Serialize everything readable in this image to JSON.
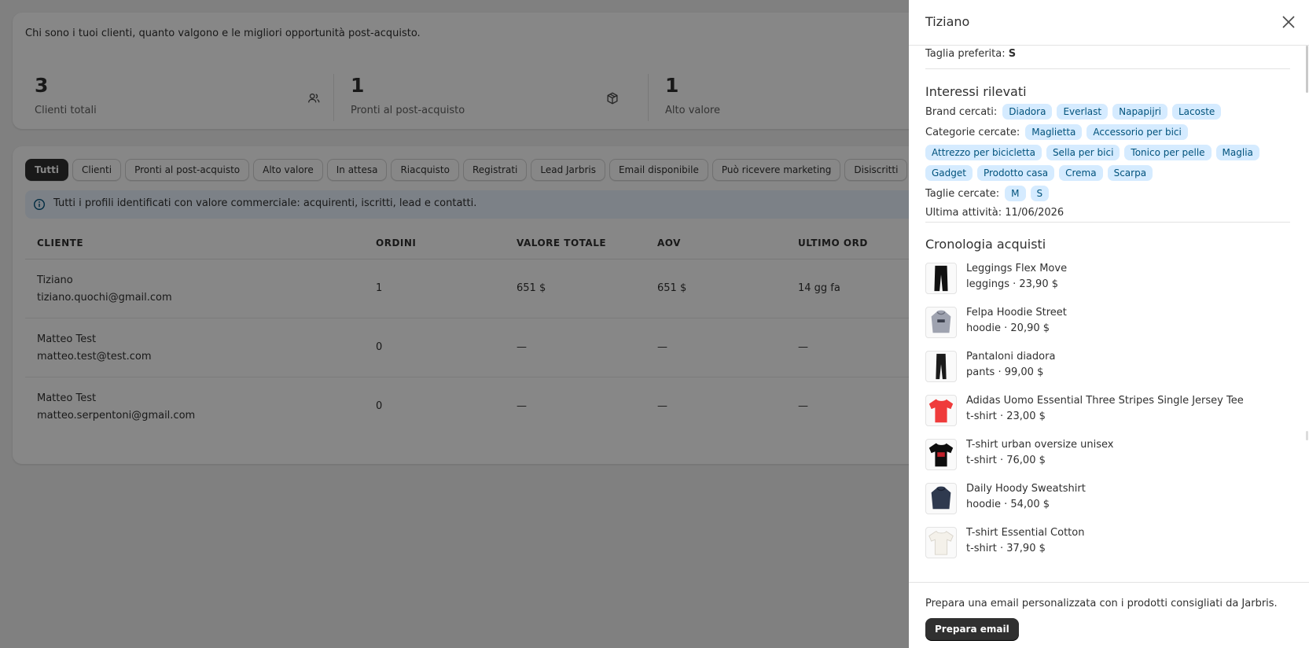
{
  "header": {
    "intro": "Chi sono i tuoi clienti, quanto valgono e le migliori opportunità post-acquisto."
  },
  "stats": [
    {
      "value": "3",
      "label": "Clienti totali",
      "icon": "users-icon"
    },
    {
      "value": "1",
      "label": "Pronti al post-acquisto",
      "icon": "package-icon"
    },
    {
      "value": "1",
      "label": "Alto valore",
      "icon": ""
    }
  ],
  "filters": [
    "Tutti",
    "Clienti",
    "Pronti al post-acquisto",
    "Alto valore",
    "In attesa",
    "Riacquisto",
    "Registrati",
    "Lead Jarbris",
    "Email disponibile",
    "Può ricevere marketing",
    "Disiscritti"
  ],
  "active_filter": "Tutti",
  "banner": {
    "text": "Tutti i profili identificati con valore commerciale: acquirenti, iscritti, lead e contatti.",
    "icon": "info-icon"
  },
  "table": {
    "headers": [
      "CLIENTE",
      "ORDINI",
      "VALORE TOTALE",
      "AOV",
      "ULTIMO ORD"
    ],
    "rows": [
      {
        "name": "Tiziano",
        "email": "tiziano.quochi@gmail.com",
        "orders": "1",
        "total": "651 $",
        "aov": "651 $",
        "last": "14 gg fa"
      },
      {
        "name": "Matteo Test",
        "email": "matteo.test@test.com",
        "orders": "0",
        "total": "—",
        "aov": "—",
        "last": "—"
      },
      {
        "name": "Matteo Test",
        "email": "matteo.serpentoni@gmail.com",
        "orders": "0",
        "total": "—",
        "aov": "—",
        "last": "—"
      }
    ]
  },
  "drawer": {
    "title": "Tiziano",
    "preferred_size_label": "Taglia preferita:",
    "preferred_size_value": "S",
    "interests_title": "Interessi rilevati",
    "brands_label": "Brand cercati:",
    "brands": [
      "Diadora",
      "Everlast",
      "Napapijri",
      "Lacoste"
    ],
    "categories_label": "Categorie cercate:",
    "categories_row1": [
      "Maglietta",
      "Accessorio per bici"
    ],
    "categories_row2": [
      "Attrezzo per bicicletta",
      "Sella per bici",
      "Tonico per pelle",
      "Maglia"
    ],
    "categories_row3": [
      "Gadget",
      "Prodotto casa",
      "Crema",
      "Scarpa"
    ],
    "sizes_label": "Taglie cercate:",
    "sizes": [
      "M",
      "S"
    ],
    "last_activity": "Ultima attività: 11/06/2026",
    "history_title": "Cronologia acquisti",
    "purchases": [
      {
        "name": "Leggings Flex Move",
        "meta": "leggings · 23,90 $",
        "thumb": "leggings"
      },
      {
        "name": "Felpa Hoodie Street",
        "meta": "hoodie · 20,90 $",
        "thumb": "hoodie-grey"
      },
      {
        "name": "Pantaloni diadora",
        "meta": "pants · 99,00 $",
        "thumb": "pants"
      },
      {
        "name": "Adidas Uomo Essential Three Stripes Single Jersey Tee",
        "meta": "t-shirt · 23,00 $",
        "thumb": "tee-red"
      },
      {
        "name": "T-shirt urban oversize unisex",
        "meta": "t-shirt · 76,00 $",
        "thumb": "tee-black"
      },
      {
        "name": "Daily Hoody Sweatshirt",
        "meta": "hoodie · 54,00 $",
        "thumb": "hoodie-navy"
      },
      {
        "name": "T-shirt Essential Cotton",
        "meta": "t-shirt · 37,90 $",
        "thumb": "tee-white"
      }
    ],
    "footer_text": "Prepara una email personalizzata con i prodotti consigliati da Jarbris.",
    "footer_button": "Prepara email"
  },
  "colors": {
    "overlay": "rgba(0,0,0,0.47)",
    "tag_bg": "#d5ebff",
    "tag_text": "#00527c",
    "primary": "#303030",
    "banner_bg": "#eaf4ff"
  }
}
